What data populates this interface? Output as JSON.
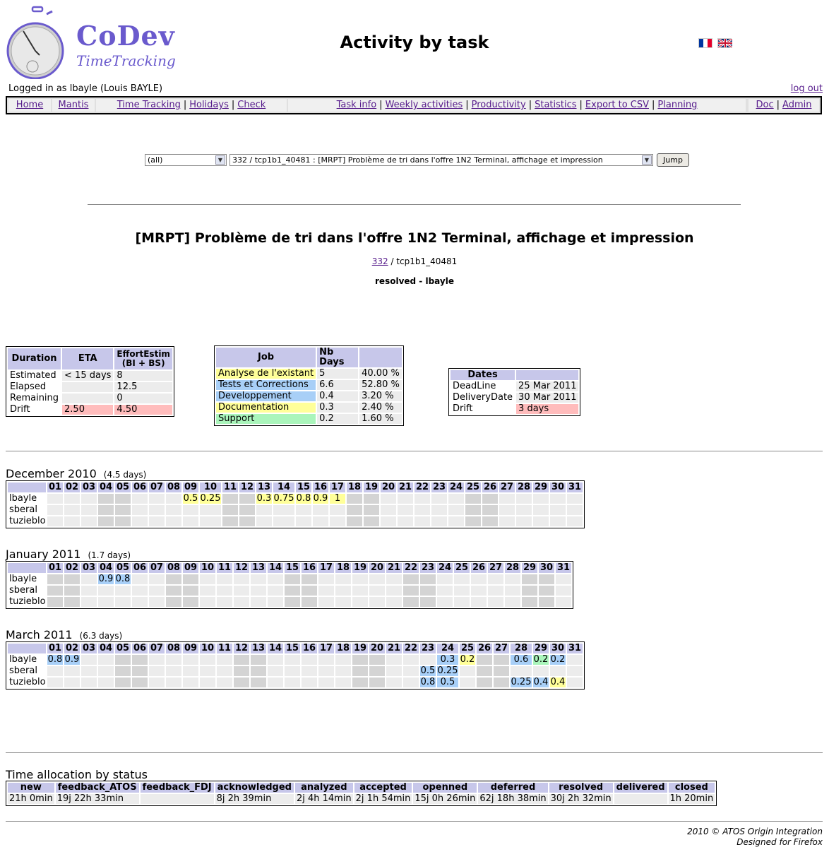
{
  "header": {
    "logo_title": "CoDev",
    "logo_subtitle": "TimeTracking",
    "page_title": "Activity by task",
    "logged_in": "Logged in as lbayle (Louis BAYLE)",
    "logout": "log out"
  },
  "nav": {
    "home": "Home",
    "mantis": "Mantis",
    "time_tracking": "Time Tracking",
    "holidays": "Holidays",
    "check": "Check",
    "task_info": "Task info",
    "weekly_activities": "Weekly activities",
    "productivity": "Productivity",
    "statistics": "Statistics",
    "export_csv": "Export to CSV",
    "planning": "Planning",
    "doc": "Doc",
    "admin": "Admin"
  },
  "filter": {
    "project_select": "(all)",
    "task_select": "332 / tcp1b1_40481 : [MRPT] Problème de tri dans l'offre 1N2 Terminal, affichage et impression",
    "jump": "Jump"
  },
  "task": {
    "title": "[MRPT] Problème de tri dans l'offre 1N2 Terminal, affichage et impression",
    "id_link": "332",
    "ext_ref": " / tcp1b1_40481",
    "status": "resolved - lbayle"
  },
  "duration_table": {
    "headers": [
      "Duration",
      "ETA",
      "EffortEstim (BI + BS)"
    ],
    "rows": [
      {
        "label": "Estimated",
        "eta": "< 15 days",
        "effort": "8"
      },
      {
        "label": "Elapsed",
        "eta": "",
        "effort": "12.5"
      },
      {
        "label": "Remaining",
        "eta": "",
        "effort": "0"
      },
      {
        "label": "Drift",
        "eta": "2.50",
        "effort": "4.50"
      }
    ]
  },
  "job_table": {
    "headers": [
      "Job",
      "Nb Days",
      ""
    ],
    "rows": [
      {
        "job": "Analyse de l'existant",
        "days": "5",
        "pct": "40.00 %",
        "color": "#ffff99"
      },
      {
        "job": "Tests et Corrections",
        "days": "6.6",
        "pct": "52.80 %",
        "color": "#a8cff7"
      },
      {
        "job": "Developpement",
        "days": "0.4",
        "pct": "3.20 %",
        "color": "#a8cff7"
      },
      {
        "job": "Documentation",
        "days": "0.3",
        "pct": "2.40 %",
        "color": "#ffff99"
      },
      {
        "job": "Support",
        "days": "0.2",
        "pct": "1.60 %",
        "color": "#aaf5bb"
      }
    ]
  },
  "dates_table": {
    "headers": [
      "Dates",
      ""
    ],
    "rows": [
      {
        "label": "DeadLine",
        "value": "25 Mar 2011"
      },
      {
        "label": "DeliveryDate",
        "value": "30 Mar 2011"
      },
      {
        "label": "Drift",
        "value": "3 days"
      }
    ]
  },
  "months": [
    {
      "title": "December 2010",
      "total": "(4.5 days)",
      "grey_days": [
        4,
        5,
        11,
        12,
        18,
        19,
        25,
        26
      ],
      "users": [
        {
          "name": "lbayle",
          "cells": {
            "9": [
              "0.5",
              "y"
            ],
            "10": [
              "0.25",
              "y"
            ],
            "13": [
              "0.3",
              "y"
            ],
            "14": [
              "0.75",
              "y"
            ],
            "15": [
              "0.8",
              "y"
            ],
            "16": [
              "0.9",
              "y"
            ],
            "17": [
              "1",
              "y"
            ]
          }
        },
        {
          "name": "sberal",
          "cells": {}
        },
        {
          "name": "tuzieblo",
          "cells": {}
        }
      ]
    },
    {
      "title": "January 2011",
      "total": "(1.7 days)",
      "grey_days": [
        1,
        2,
        8,
        9,
        15,
        16,
        22,
        23,
        29,
        30
      ],
      "users": [
        {
          "name": "lbayle",
          "cells": {
            "4": [
              "0.9",
              "b"
            ],
            "5": [
              "0.8",
              "b"
            ]
          }
        },
        {
          "name": "sberal",
          "cells": {}
        },
        {
          "name": "tuzieblo",
          "cells": {}
        }
      ]
    },
    {
      "title": "March 2011",
      "total": "(6.3 days)",
      "grey_days": [
        5,
        6,
        12,
        13,
        19,
        20,
        26,
        27
      ],
      "users": [
        {
          "name": "lbayle",
          "cells": {
            "1": [
              "0.8",
              "b"
            ],
            "2": [
              "0.9",
              "b"
            ],
            "24": [
              "0.3",
              "b"
            ],
            "25": [
              "0.2",
              "y"
            ],
            "28": [
              "0.6",
              "b"
            ],
            "29": [
              "0.2",
              "g"
            ],
            "30": [
              "0.2",
              "b"
            ]
          }
        },
        {
          "name": "sberal",
          "cells": {
            "23": [
              "0.5",
              "b"
            ],
            "24": [
              "0.25",
              "b"
            ]
          }
        },
        {
          "name": "tuzieblo",
          "cells": {
            "23": [
              "0.8",
              "b"
            ],
            "24": [
              "0.5",
              "b"
            ],
            "28": [
              "0.25",
              "b"
            ],
            "29": [
              "0.4",
              "b"
            ],
            "30": [
              "0.4",
              "y"
            ]
          }
        }
      ]
    }
  ],
  "status_section": {
    "title": "Time allocation by status",
    "headers": [
      "new",
      "feedback_ATOS",
      "feedback_FDJ",
      "acknowledged",
      "analyzed",
      "accepted",
      "openned",
      "deferred",
      "resolved",
      "delivered",
      "closed"
    ],
    "values": [
      "21h 0min",
      "19j 22h 33min",
      "",
      "8j 2h 39min",
      "2j 4h 14min",
      "2j 1h 54min",
      "15j 0h 26min",
      "62j 18h 38min",
      "30j 2h 32min",
      "",
      "1h 20min"
    ]
  },
  "footer": {
    "line1": "2010 © ATOS Origin Integration",
    "line2": "Designed for Firefox"
  }
}
